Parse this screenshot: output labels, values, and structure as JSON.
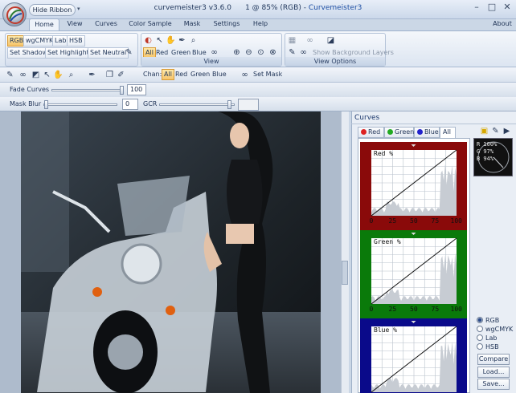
{
  "app": {
    "hide_ribbon": "Hide Ribbon",
    "quick_menu": "▾",
    "title_main": "curvemeister3 v3.6.0",
    "title_doc": "1 @ 85% (RGB)",
    "title_app": "Curvemeister3",
    "about": "About"
  },
  "tabs": [
    "Home",
    "View",
    "Curves",
    "Color Sample",
    "Mask",
    "Settings",
    "Help"
  ],
  "ribbon": {
    "colorspace": [
      "RGB",
      "wgCMYK",
      "Lab",
      "HSB"
    ],
    "set_shadow": "Set Shadow",
    "set_highlight": "Set Highlight",
    "set_neutral": "Set Neutral",
    "view_group": "View",
    "channels": [
      "All",
      "Red",
      "Green",
      "Blue"
    ],
    "show_background_layers": "Show Background Layers",
    "view_options_group": "View Options"
  },
  "toolbar": {
    "chan_label": "Chan:",
    "channels": [
      "All",
      "Red",
      "Green",
      "Blue"
    ],
    "set_mask": "Set Mask",
    "fade_curves_label": "Fade Curves",
    "fade_curves_value": "100",
    "fade_curves_level": 1.0,
    "mask_blur_label": "Mask Blur",
    "mask_blur_value": "0",
    "gcr_label": "GCR",
    "gcr_level": 0.95
  },
  "curves_panel": {
    "title": "Curves",
    "tabs": [
      "Red",
      "Green",
      "Blue",
      "All"
    ],
    "curves": [
      {
        "name": "Red %",
        "color": "#8a0a0a",
        "ticks": [
          "0",
          "25",
          "50",
          "75",
          "100"
        ]
      },
      {
        "name": "Green %",
        "color": "#0a7a0a",
        "ticks": [
          "0",
          "25",
          "50",
          "75",
          "100"
        ]
      },
      {
        "name": "Blue %",
        "color": "#0a0a8a",
        "ticks": [
          "0",
          "25",
          "50",
          "75",
          "100"
        ]
      }
    ],
    "readout": {
      "r": "R 100%",
      "g": "G  97%",
      "b": "B  94%"
    },
    "modes": [
      "RGB",
      "wgCMYK",
      "Lab",
      "HSB"
    ],
    "selected_mode": "RGB",
    "compare": "Compare",
    "load": "Load...",
    "save": "Save..."
  }
}
